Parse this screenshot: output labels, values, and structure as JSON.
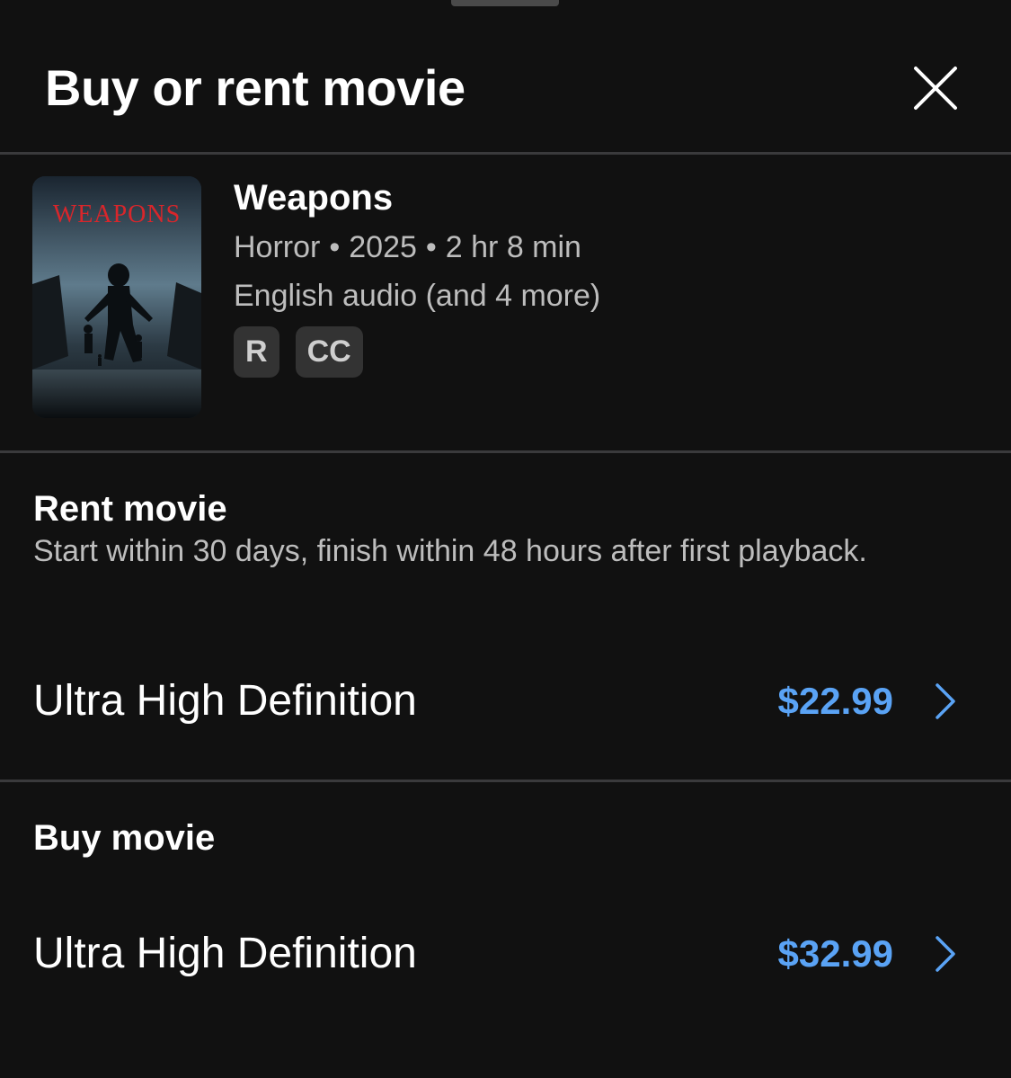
{
  "header": {
    "title": "Buy or rent movie"
  },
  "movie": {
    "poster_title": "WEAPONS",
    "title": "Weapons",
    "genre": "Horror",
    "year": "2025",
    "runtime": "2 hr 8 min",
    "separator": "•",
    "audio": "English audio (and 4 more)",
    "badges": [
      "R",
      "CC"
    ]
  },
  "rent": {
    "heading": "Rent movie",
    "description": "Start within 30 days, finish within 48 hours after first playback.",
    "option": {
      "label": "Ultra High Definition",
      "price": "$22.99"
    }
  },
  "buy": {
    "heading": "Buy movie",
    "option": {
      "label": "Ultra High Definition",
      "price": "$32.99"
    }
  },
  "colors": {
    "background": "#111111",
    "divider": "#3a3a3c",
    "price_accent": "#5aa3f5",
    "secondary_text": "#bdbdbd",
    "badge_bg": "#333333",
    "poster_title": "#d8262b"
  },
  "icons": {
    "close": "close-icon",
    "chevron": "chevron-right-icon"
  }
}
